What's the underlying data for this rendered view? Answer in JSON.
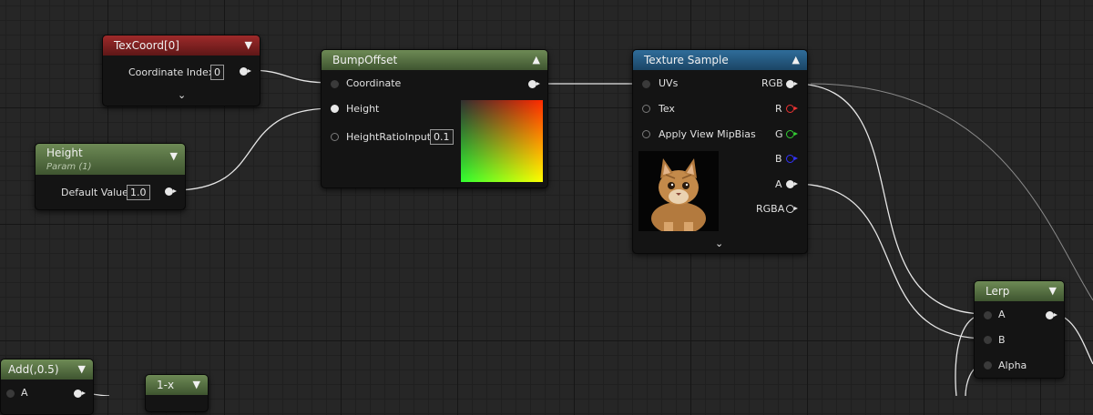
{
  "nodes": {
    "texcoord": {
      "title": "TexCoord[0]",
      "coordinate_index_label": "Coordinate Index",
      "coordinate_index_value": "0"
    },
    "height": {
      "title": "Height",
      "subtitle": "Param (1)",
      "default_value_label": "Default Value",
      "default_value": "1.0"
    },
    "bumpoffset": {
      "title": "BumpOffset",
      "pins": {
        "coordinate": "Coordinate",
        "height": "Height",
        "height_ratio": "HeightRatioInput"
      },
      "height_ratio_value": "0.1"
    },
    "texture_sample": {
      "title": "Texture Sample",
      "inputs": {
        "uvs": "UVs",
        "tex": "Tex",
        "mipbias": "Apply View MipBias"
      },
      "outputs": {
        "rgb": "RGB",
        "r": "R",
        "g": "G",
        "b": "B",
        "a": "A",
        "rgba": "RGBA"
      }
    },
    "lerp": {
      "title": "Lerp",
      "pins": {
        "a": "A",
        "b": "B",
        "alpha": "Alpha"
      }
    },
    "add": {
      "title": "Add(,0.5)",
      "pin_a": "A"
    },
    "oneminus": {
      "title": "1-x"
    }
  },
  "colors": {
    "header_red": "#9e2a2a",
    "header_green": "#5c7a47",
    "header_blue": "#2f6d9a",
    "wire": "#e6e6e6",
    "pin_r": "#ee3333",
    "pin_g": "#33cc33",
    "pin_b": "#3333ff"
  },
  "icons": {
    "collapse": "chevron-up-icon",
    "expand": "chevron-down-icon",
    "preview": "kitten-texture-preview"
  }
}
